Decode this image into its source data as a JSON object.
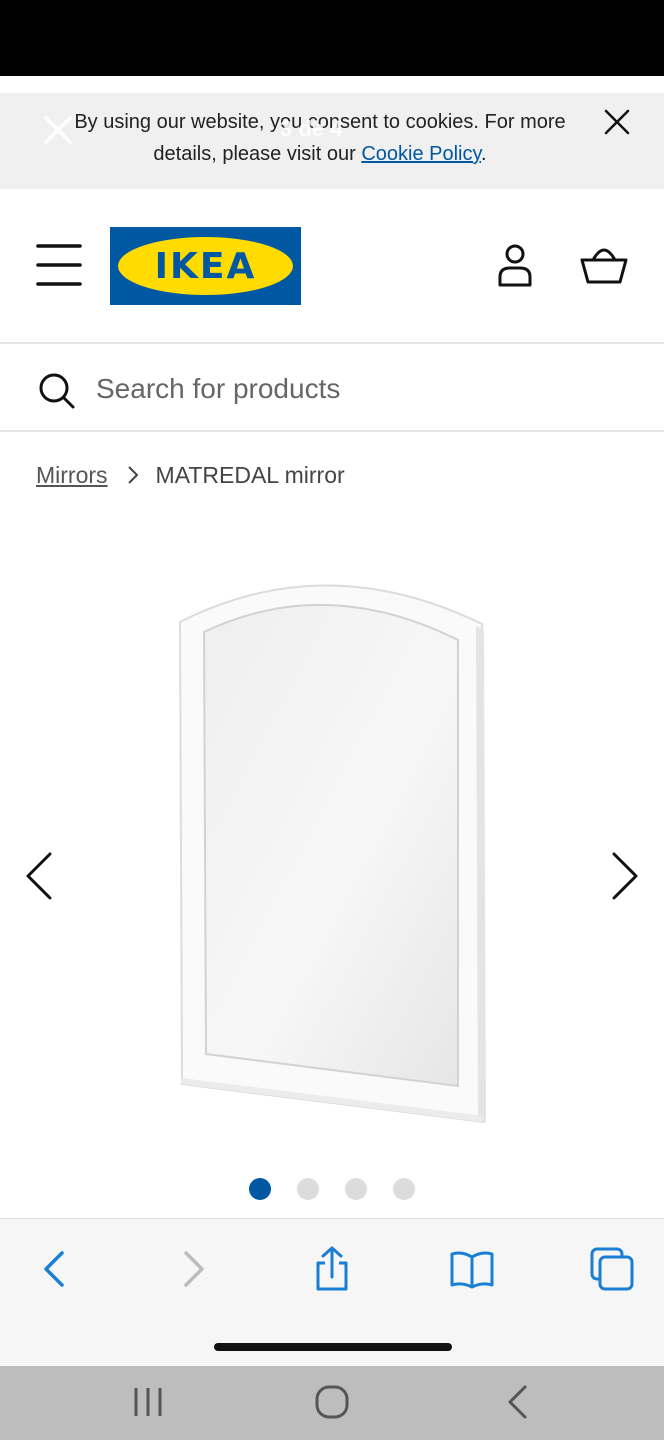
{
  "status_bar": {},
  "cookie_banner": {
    "line1": "By using our website, you consent to cookies. For more",
    "line2_prefix": "details, please visit our ",
    "link_text": "Cookie Policy",
    "line2_suffix": "."
  },
  "overlay": {
    "counter": "3 de 4"
  },
  "header": {
    "logo_text": "IKEA",
    "icons": [
      "menu-icon",
      "account-icon",
      "basket-icon"
    ]
  },
  "search": {
    "placeholder": "Search for products"
  },
  "breadcrumb": {
    "parent": "Mirrors",
    "current": "MATREDAL mirror"
  },
  "gallery": {
    "image_total": 4,
    "active_index": 1
  },
  "browser_toolbar": {
    "icons": [
      "back-icon",
      "forward-icon",
      "share-icon",
      "bookmarks-icon",
      "tabs-icon"
    ]
  },
  "android_nav": {
    "icons": [
      "recent-apps-icon",
      "home-icon",
      "system-back-icon"
    ]
  },
  "colors": {
    "accent_blue": "#0058a3",
    "ikea_yellow": "#ffdb00",
    "toolbar_icon": "#1a7fd4"
  }
}
